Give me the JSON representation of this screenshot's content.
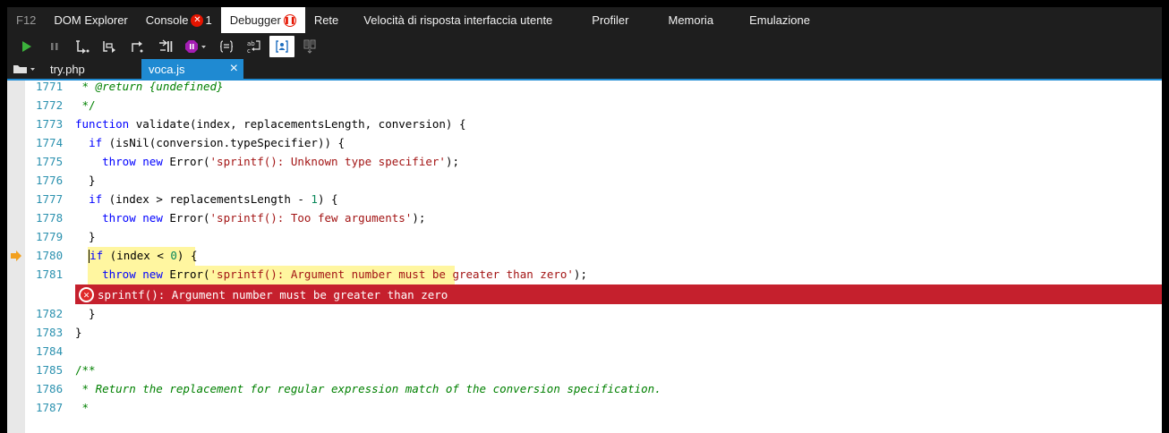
{
  "top_tabs": {
    "f12": "F12",
    "dom_explorer": "DOM Explorer",
    "console": "Console",
    "console_error_count": "1",
    "debugger": "Debugger",
    "network": "Rete",
    "ui_responsiveness": "Velocità di risposta interfaccia utente",
    "profiler": "Profiler",
    "memory": "Memoria",
    "emulation": "Emulazione"
  },
  "doc_tabs": {
    "tab1": "try.php",
    "tab2": "voca.js",
    "close": "×"
  },
  "colors": {
    "accent": "#1f8ad2",
    "error_bar": "#c5202d",
    "current_statement": "#fff6a0",
    "line_number": "#2b91af"
  },
  "code": {
    "lines": [
      {
        "n": "1771",
        "text": " * @return {undefined}"
      },
      {
        "n": "1772",
        "text": " */"
      },
      {
        "n": "1773",
        "text": "function validate(index, replacementsLength, conversion) {"
      },
      {
        "n": "1774",
        "text": "  if (isNil(conversion.typeSpecifier)) {"
      },
      {
        "n": "1775",
        "text": "    throw new Error('sprintf(): Unknown type specifier');"
      },
      {
        "n": "1776",
        "text": "  }"
      },
      {
        "n": "1777",
        "text": "  if (index > replacementsLength - 1) {"
      },
      {
        "n": "1778",
        "text": "    throw new Error('sprintf(): Too few arguments');"
      },
      {
        "n": "1779",
        "text": "  }"
      },
      {
        "n": "1780",
        "text": "  if (index < 0) {"
      },
      {
        "n": "1781",
        "text": "    throw new Error('sprintf(): Argument number must be greater than zero');"
      },
      {
        "n": "1782",
        "text": "  }"
      },
      {
        "n": "1783",
        "text": "}"
      },
      {
        "n": "1784",
        "text": ""
      },
      {
        "n": "1785",
        "text": "/**"
      },
      {
        "n": "1786",
        "text": " * Return the replacement for regular expression match of the conversion specification."
      },
      {
        "n": "1787",
        "text": " *"
      }
    ],
    "error_message": "sprintf(): Argument number must be greater than zero",
    "current_line": "1780"
  },
  "icons": {
    "continue": "play-icon",
    "break": "pause-icon",
    "step_into": "step-into-icon",
    "step_over": "step-over-icon",
    "step_out": "step-out-icon",
    "break_on_new_worker": "break-new-worker-icon",
    "exception_behavior": "exception-behavior-icon",
    "pretty_print": "pretty-print-icon",
    "word_wrap": "word-wrap-icon",
    "just_my_code": "just-my-code-icon",
    "source_maps": "source-maps-icon"
  }
}
